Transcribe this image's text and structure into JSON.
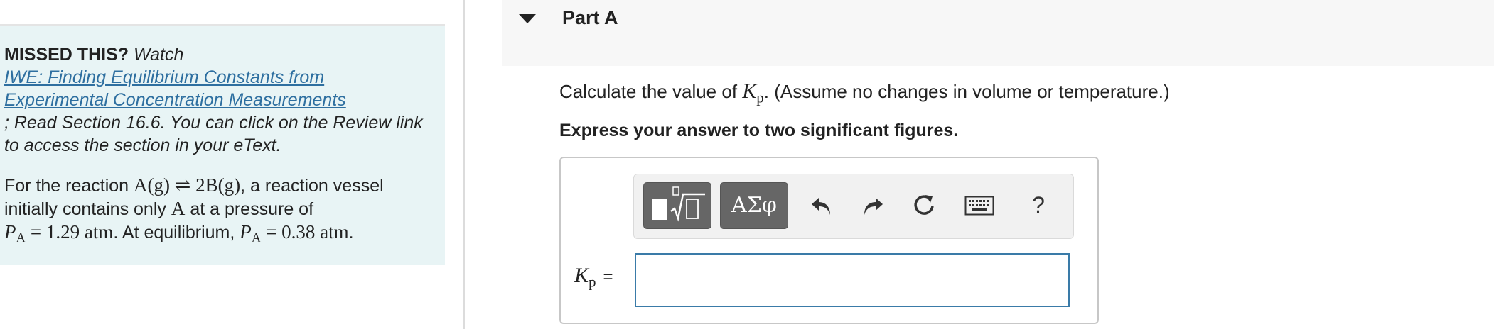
{
  "hint": {
    "missed_label": "MISSED THIS?",
    "watch_label": "Watch",
    "video_link": "IWE: Finding Equilibrium Constants from Experimental Concentration Measurements",
    "read_text": "; Read Section 16.6. You can click on the Review link to access the section in your eText.",
    "reaction_intro": "For the reaction",
    "reaction_eq": "A(g) ⇌ 2B(g)",
    "reaction_mid": ", a reaction vessel initially contains only",
    "species_a": "A",
    "pressure_intro": "at a pressure of",
    "pa_initial": "1.29 atm",
    "eq_text": ". At equilibrium,",
    "pa_equilibrium": "0.38 atm",
    "p_symbol": "P",
    "p_sub": "A",
    "equals": "="
  },
  "part": {
    "title": "Part A",
    "question_prefix": "Calculate the value of",
    "question_suffix": ". (Assume no changes in volume or temperature.)",
    "k_symbol": "K",
    "k_sub": "p",
    "instruction": "Express your answer to two significant figures."
  },
  "toolbar": {
    "greek_label": "ΑΣφ",
    "help_label": "?"
  },
  "answer": {
    "label_symbol": "K",
    "label_sub": "p",
    "label_equals": "=",
    "value": ""
  }
}
